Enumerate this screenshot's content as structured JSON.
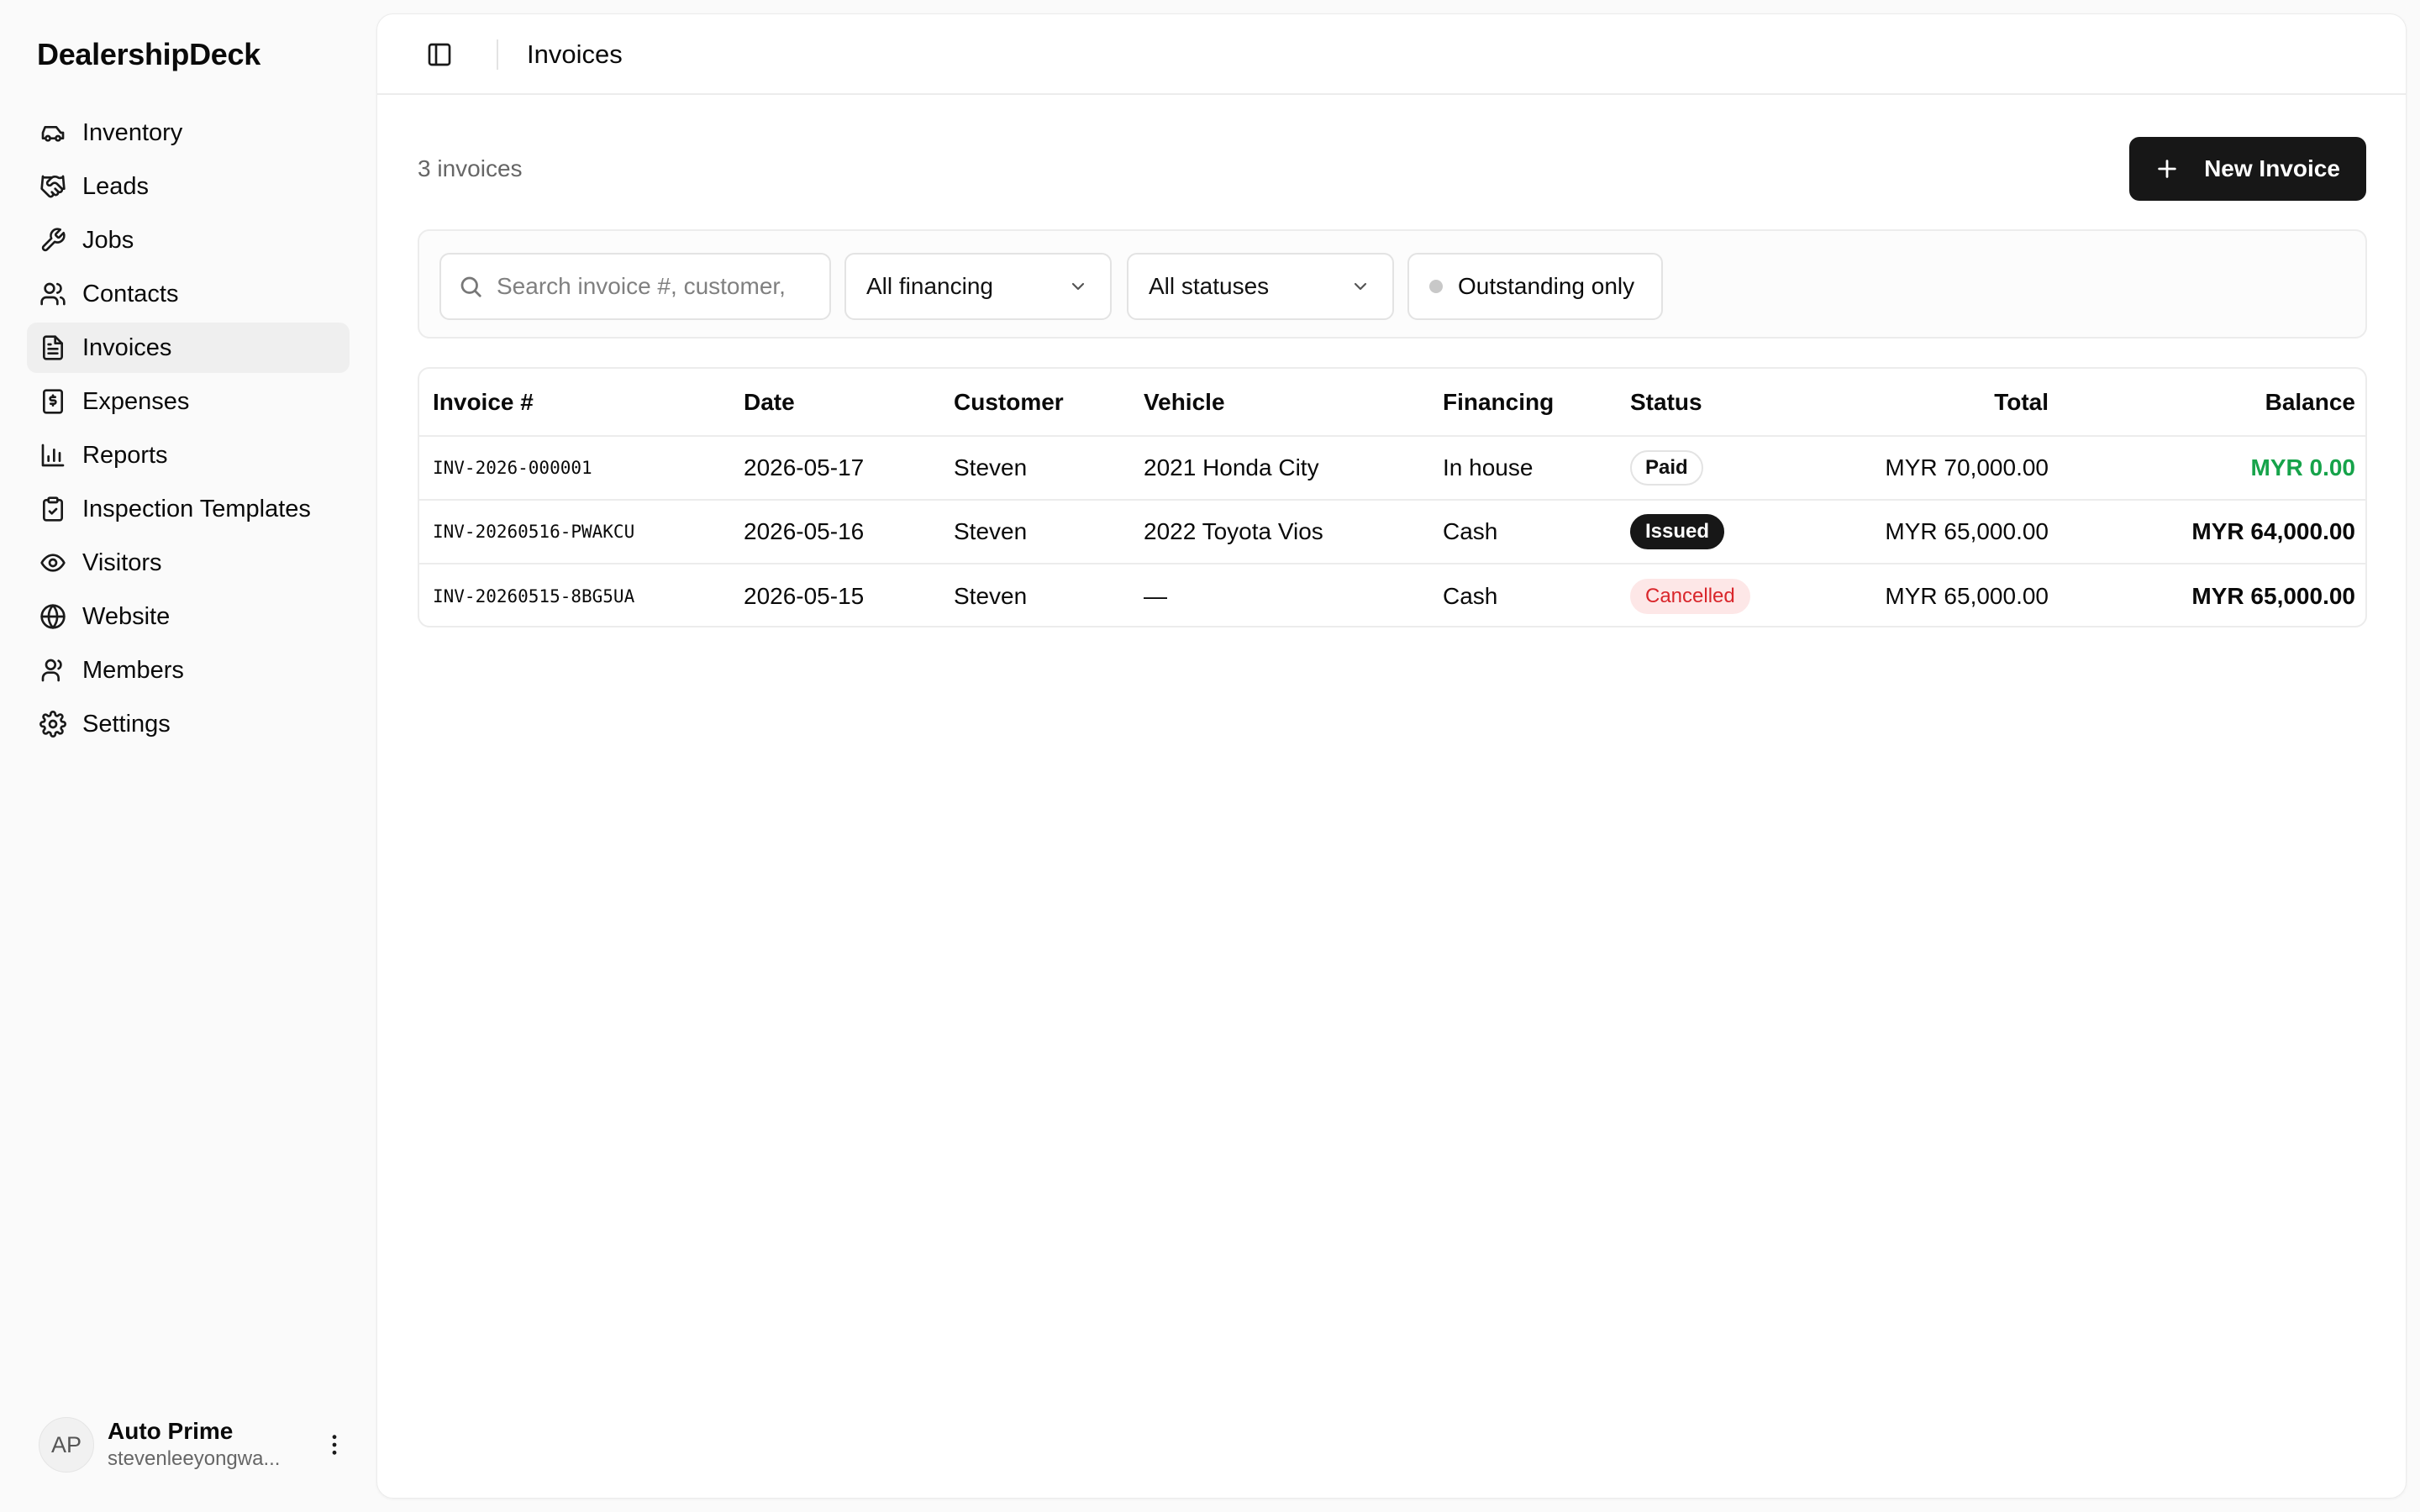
{
  "brand": "DealershipDeck",
  "nav": [
    {
      "label": "Inventory",
      "icon": "car-icon"
    },
    {
      "label": "Leads",
      "icon": "handshake-icon"
    },
    {
      "label": "Jobs",
      "icon": "wrench-icon"
    },
    {
      "label": "Contacts",
      "icon": "users-icon"
    },
    {
      "label": "Invoices",
      "icon": "file-text-icon",
      "active": true
    },
    {
      "label": "Expenses",
      "icon": "receipt-icon"
    },
    {
      "label": "Reports",
      "icon": "bar-chart-icon"
    },
    {
      "label": "Inspection Templates",
      "icon": "clipboard-check-icon"
    },
    {
      "label": "Visitors",
      "icon": "eye-icon"
    },
    {
      "label": "Website",
      "icon": "globe-icon"
    },
    {
      "label": "Members",
      "icon": "user-group-icon"
    },
    {
      "label": "Settings",
      "icon": "gear-icon"
    }
  ],
  "user": {
    "initials": "AP",
    "name": "Auto Prime",
    "email": "stevenleeyongwa..."
  },
  "header": {
    "title": "Invoices"
  },
  "summary": {
    "count_text": "3 invoices"
  },
  "actions": {
    "new_invoice": "New Invoice"
  },
  "filters": {
    "search_placeholder": "Search invoice #, customer,",
    "financing": "All financing",
    "status": "All statuses",
    "outstanding": "Outstanding only"
  },
  "table": {
    "headers": {
      "invoice": "Invoice #",
      "date": "Date",
      "customer": "Customer",
      "vehicle": "Vehicle",
      "financing": "Financing",
      "status": "Status",
      "total": "Total",
      "balance": "Balance"
    },
    "rows": [
      {
        "invoice": "INV-2026-000001",
        "date": "2026-05-17",
        "customer": "Steven",
        "vehicle": "2021 Honda City",
        "financing": "In house",
        "status": "Paid",
        "total": "MYR 70,000.00",
        "balance": "MYR 0.00"
      },
      {
        "invoice": "INV-20260516-PWAKCU",
        "date": "2026-05-16",
        "customer": "Steven",
        "vehicle": "2022 Toyota Vios",
        "financing": "Cash",
        "status": "Issued",
        "total": "MYR 65,000.00",
        "balance": "MYR 64,000.00"
      },
      {
        "invoice": "INV-20260515-8BG5UA",
        "date": "2026-05-15",
        "customer": "Steven",
        "vehicle": "—",
        "financing": "Cash",
        "status": "Cancelled",
        "total": "MYR 65,000.00",
        "balance": "MYR 65,000.00"
      }
    ]
  },
  "colors": {
    "primary": "#171717",
    "paid_balance": "#16a34a",
    "cancelled": "#d9262b",
    "cancelled_bg": "#fde7e7"
  }
}
